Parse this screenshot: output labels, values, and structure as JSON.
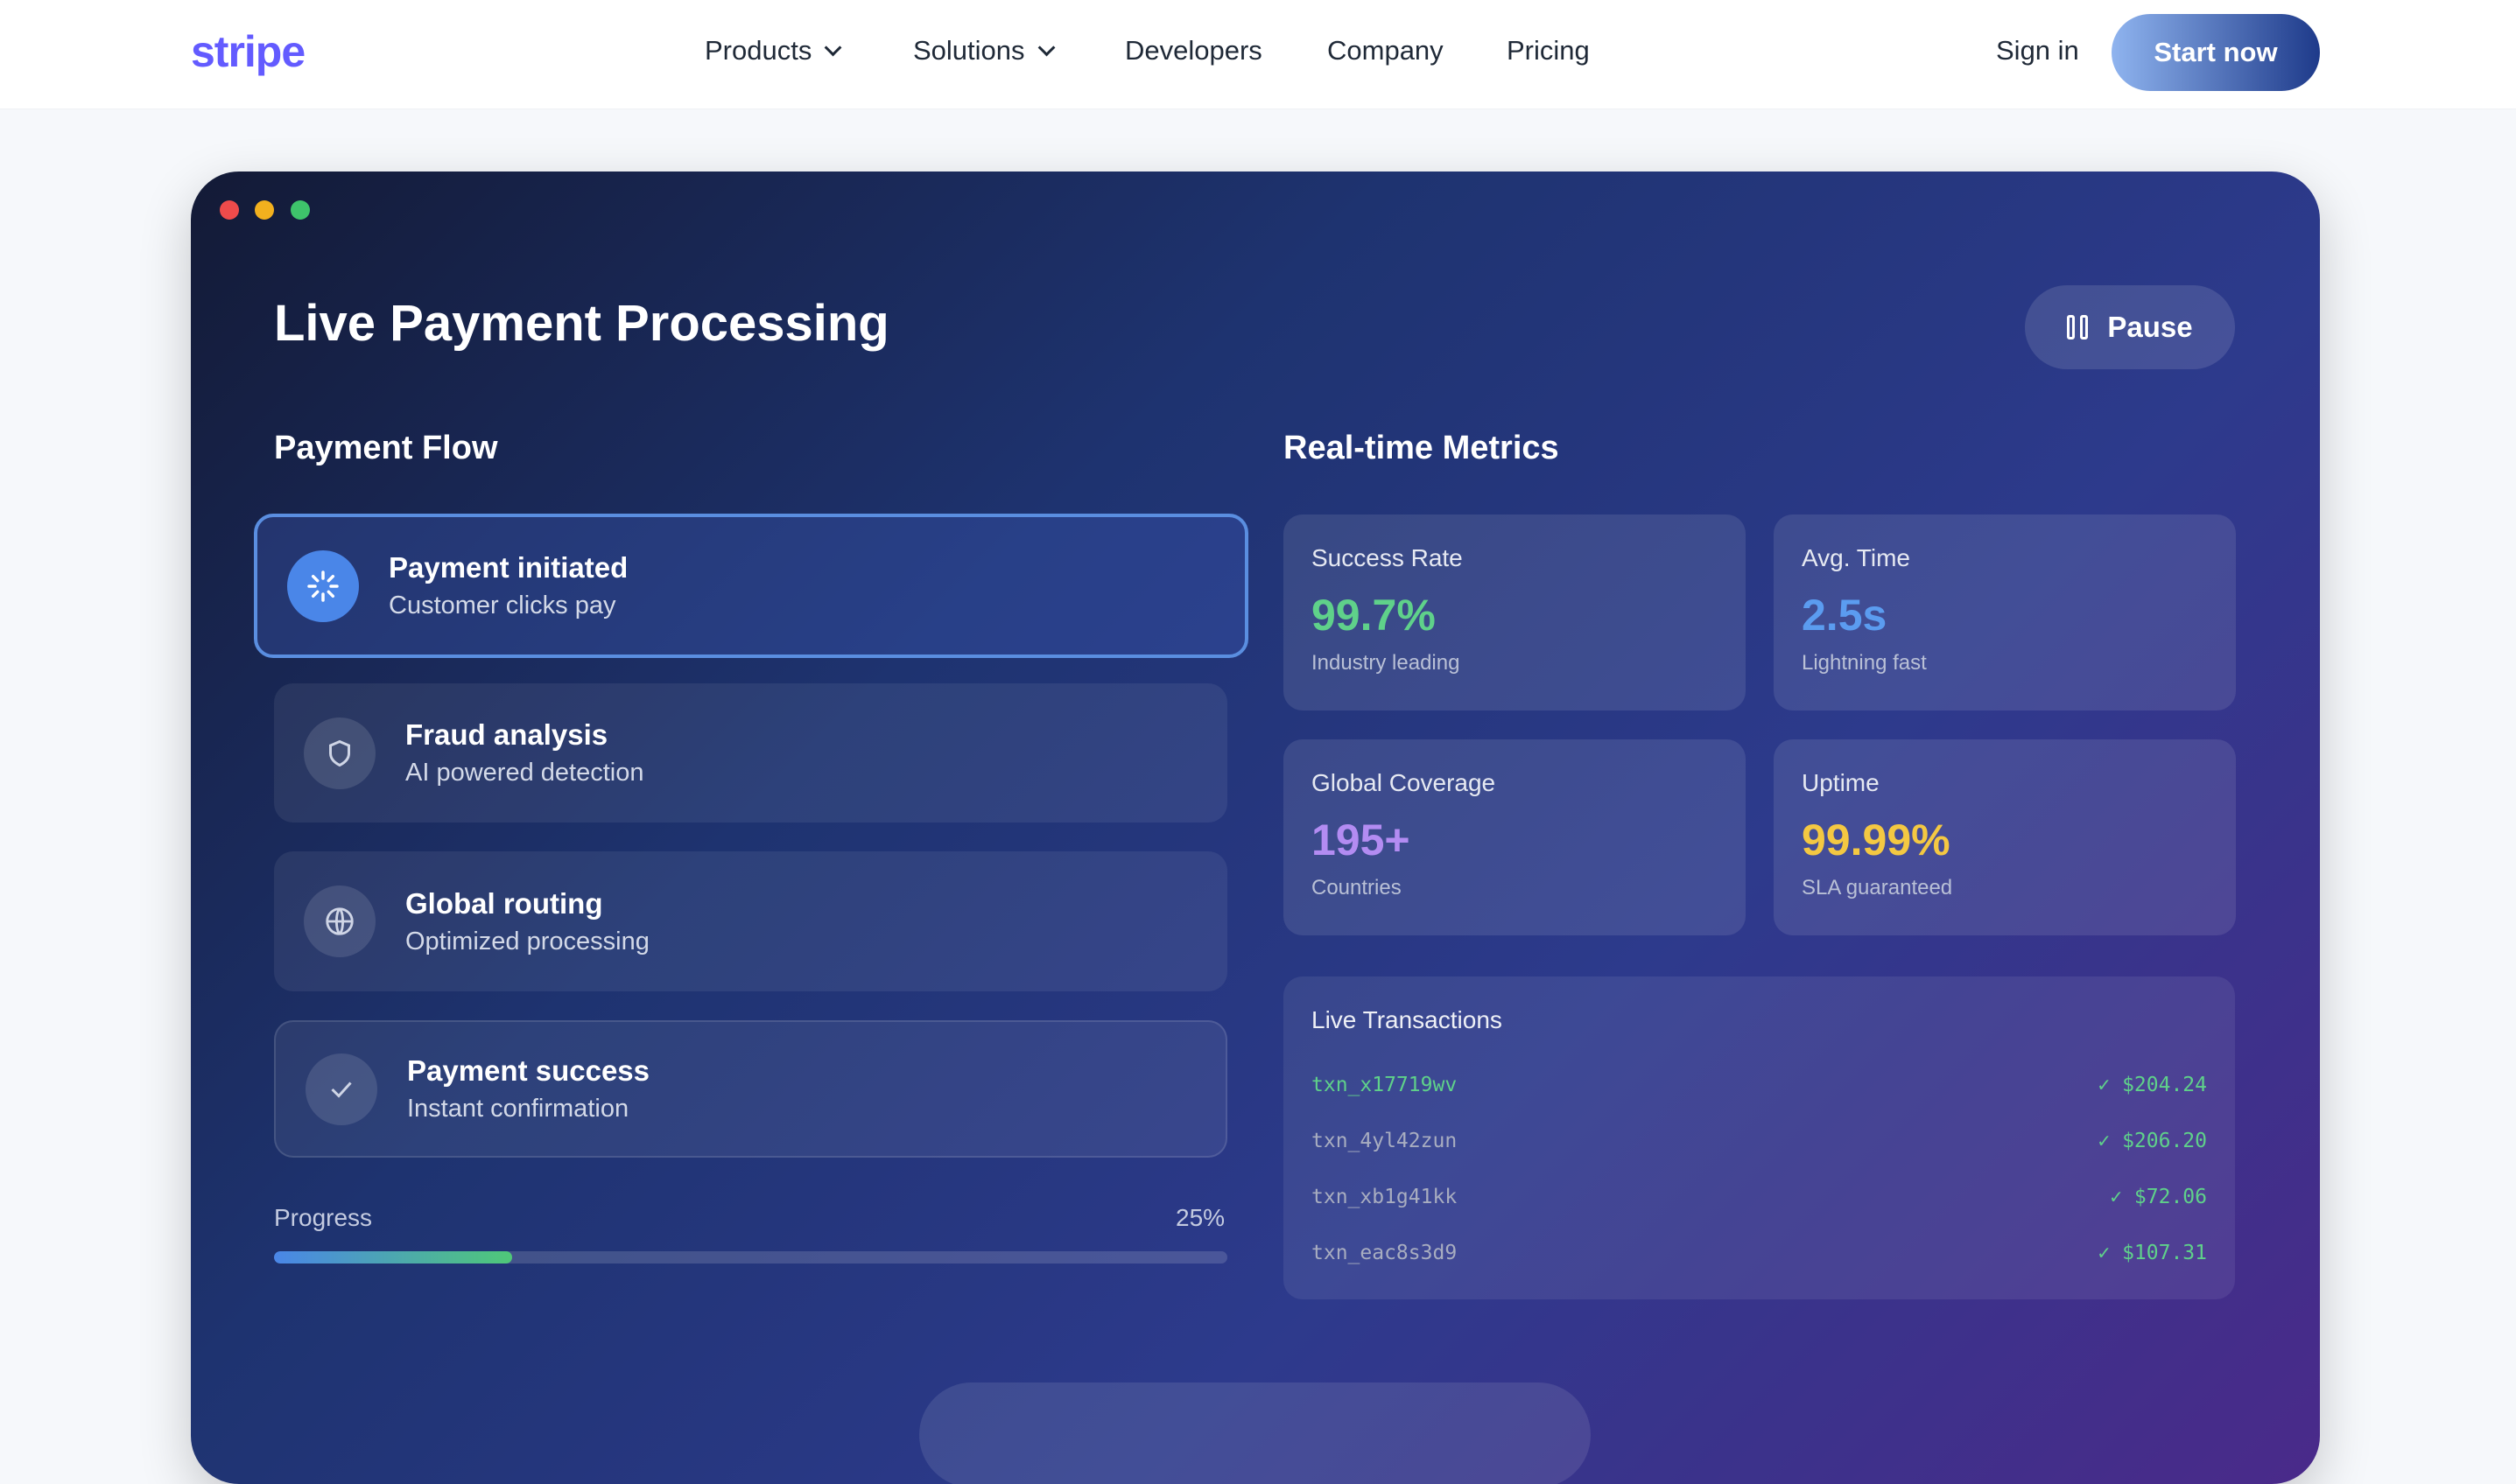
{
  "nav": {
    "logo": "stripe",
    "links": [
      {
        "label": "Products",
        "dropdown": true
      },
      {
        "label": "Solutions",
        "dropdown": true
      },
      {
        "label": "Developers"
      },
      {
        "label": "Company"
      },
      {
        "label": "Pricing"
      }
    ],
    "sign_in": "Sign in",
    "start": "Start now"
  },
  "demo": {
    "title": "Live Payment Processing",
    "pause_label": "Pause",
    "flow_title": "Payment Flow",
    "steps": [
      {
        "title": "Payment initiated",
        "subtitle": "Customer clicks pay",
        "icon": "spinner-icon",
        "active": true
      },
      {
        "title": "Fraud analysis",
        "subtitle": "AI powered detection",
        "icon": "shield-icon"
      },
      {
        "title": "Global routing",
        "subtitle": "Optimized processing",
        "icon": "globe-icon"
      },
      {
        "title": "Payment success",
        "subtitle": "Instant confirmation",
        "icon": "check-icon"
      }
    ],
    "progress_label": "Progress",
    "progress_text": "25%",
    "progress_value": 25,
    "metrics_title": "Real-time Metrics",
    "metrics": [
      {
        "label": "Success Rate",
        "value": "99.7%",
        "sub": "Industry leading",
        "color": "#5fd18a"
      },
      {
        "label": "Avg. Time",
        "value": "2.5s",
        "sub": "Lightning fast",
        "color": "#5b9cf0"
      },
      {
        "label": "Global Coverage",
        "value": "195+",
        "sub": "Countries",
        "color": "#b38cf2"
      },
      {
        "label": "Uptime",
        "value": "99.99%",
        "sub": "SLA guaranteed",
        "color": "#f4c842"
      }
    ],
    "tx_title": "Live Transactions",
    "transactions": [
      {
        "id": "txn_x17719wv",
        "amount": "✓ $204.24"
      },
      {
        "id": "txn_4yl42zun",
        "amount": "✓ $206.20"
      },
      {
        "id": "txn_xb1g41kk",
        "amount": "✓ $72.06"
      },
      {
        "id": "txn_eac8s3d9",
        "amount": "✓ $107.31"
      }
    ]
  }
}
